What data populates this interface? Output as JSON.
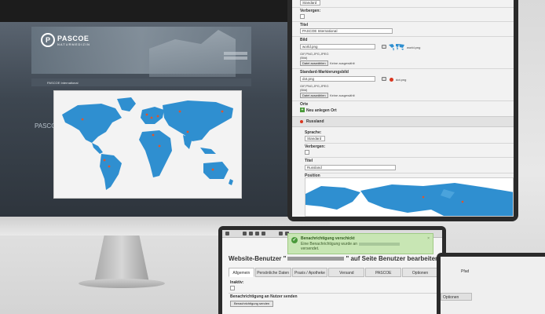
{
  "monitor": {
    "logo_initial": "P",
    "logo_name": "PASCOE",
    "logo_sub": "NATURMEDIZIN",
    "nav_text": "PASCOE International",
    "side_text": "PASCOE"
  },
  "panel_top": {
    "language_value": "Standard",
    "hidden_label": "Verbergen:",
    "title_label": "Titel",
    "title_value": "PASCOE International",
    "image_label": "Bild",
    "image_value": "world.png",
    "image_filename": "world.png",
    "formats_text": "GIF,PNG,JPG,JPEG",
    "formats_sub": "(Bild)",
    "choose_file_label": "Datei auswählen",
    "no_file_text": "Keine ausgewählt",
    "marker_label": "Standard-Markierungsbild",
    "marker_value": "dot.png",
    "marker_filename": "dot.png",
    "locations_label": "Orte",
    "new_location_label": "Neu anlegen Ort",
    "location_name": "Russland",
    "language_label": "Sprache:",
    "language_value2": "Standard",
    "hidden_label2": "Verbergen:",
    "title_label2": "Titel",
    "title_value2": "Russland",
    "position_label": "Position"
  },
  "panel_bottom": {
    "title_prefix": "Website-Benutzer \"",
    "title_suffix": "\" auf Seite Benutzer bearbeiten",
    "tabs": [
      "Allgemein",
      "Persönliche Daten",
      "Praxis / Apotheke",
      "Versand",
      "PASCOE",
      "Optionen"
    ],
    "inactive_label": "Inaktiv:",
    "send_section": "Benachrichtigung an Nutzer senden",
    "send_button": "Benachrichtigung senden"
  },
  "notification": {
    "title": "Benachrichtigung verschickt",
    "text_line1": "Eine Benachrichtigung wurde an",
    "text_line2": "versendet.",
    "close": "×"
  },
  "panel_side": {
    "pfad": "Pfad",
    "options": "Optionen"
  },
  "colors": {
    "map_land": "#2f8fd0",
    "marker": "#e0552a",
    "notification_bg": "#c8e6b4"
  }
}
